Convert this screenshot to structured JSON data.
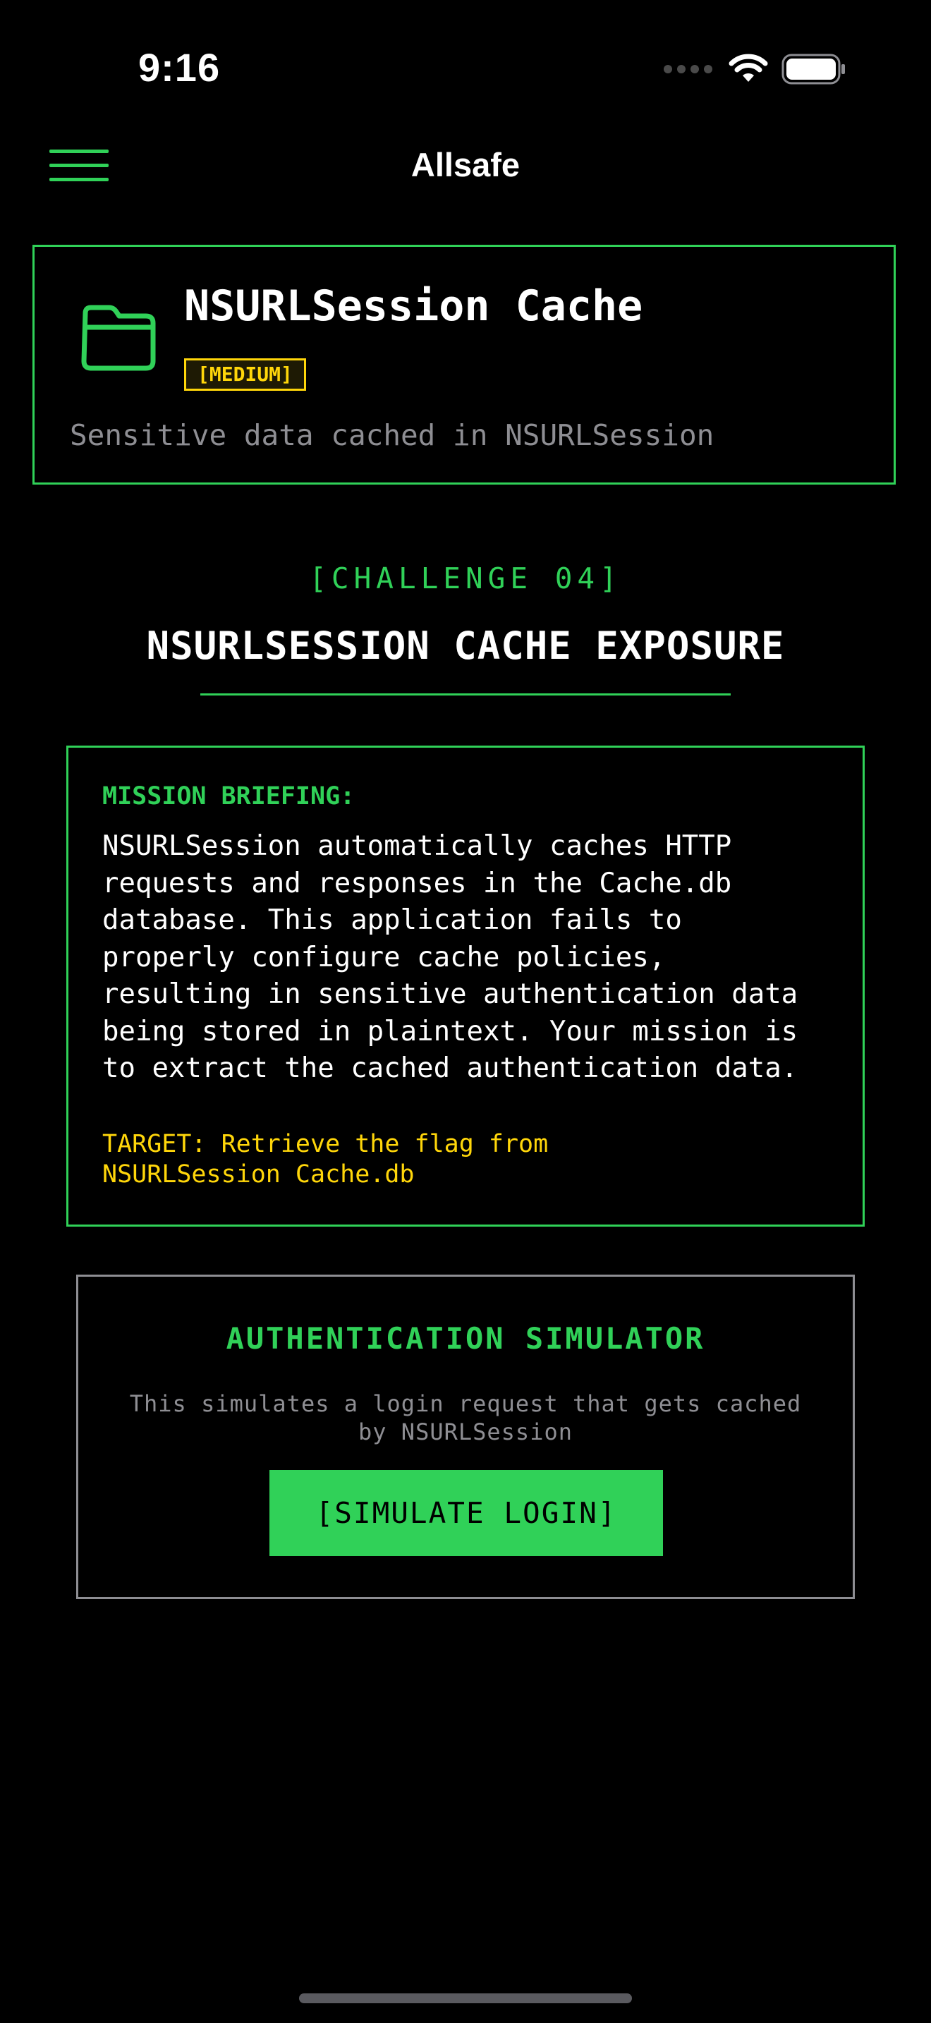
{
  "status_bar": {
    "time": "9:16"
  },
  "nav": {
    "title": "Allsafe",
    "menu_icon": "hamburger-menu-icon"
  },
  "challenge_card": {
    "icon": "folder-icon",
    "title": "NSURLSession Cache",
    "difficulty": "[MEDIUM]",
    "description": "Sensitive data cached in NSURLSession"
  },
  "challenge": {
    "label": "[CHALLENGE 04]",
    "title": "NSURLSESSION CACHE EXPOSURE"
  },
  "briefing": {
    "label": "MISSION BRIEFING:",
    "text": "NSURLSession automatically caches HTTP\nrequests and responses in the Cache.db\ndatabase. This application fails to\nproperly configure cache policies,\nresulting in sensitive authentication data\nbeing stored in plaintext. Your mission is\nto extract the cached authentication data.",
    "target": "TARGET: Retrieve the flag from\nNSURLSession Cache.db"
  },
  "simulator": {
    "title": "AUTHENTICATION SIMULATOR",
    "description": "This simulates a login request that gets cached\nby NSURLSession",
    "button_label": "[SIMULATE LOGIN]"
  },
  "colors": {
    "accent_green": "#30d158",
    "warning_yellow": "#ffd60a",
    "muted_gray": "#8e8e93",
    "background": "#000000"
  }
}
